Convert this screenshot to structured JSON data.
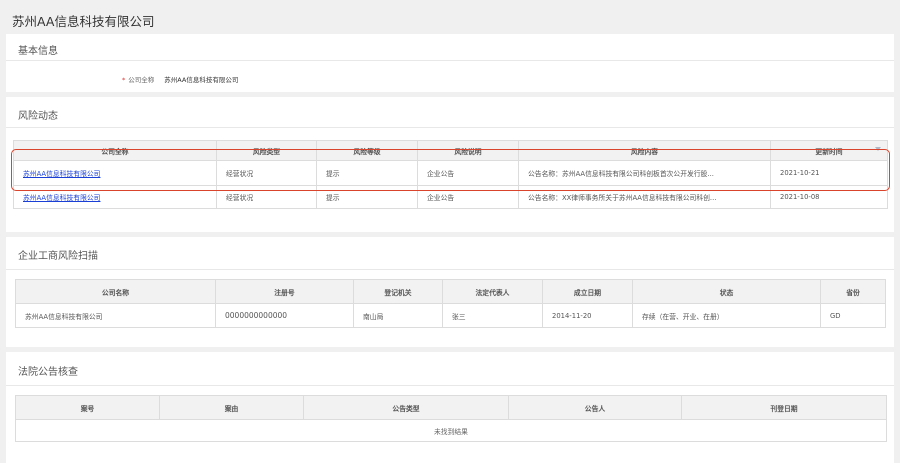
{
  "page": {
    "title": "苏州AA信息科技有限公司"
  },
  "basic_info": {
    "section_title": "基本信息",
    "field_label": "公司全称",
    "field_value": "苏州AA信息科技有限公司"
  },
  "risk": {
    "section_title": "风险动态",
    "headers": [
      "公司全称",
      "风险类型",
      "风险等级",
      "风险说明",
      "风险内容",
      "更新时间"
    ],
    "rows": [
      {
        "company": "苏州AA信息科技有限公司",
        "type": "经营状况",
        "level": "提示",
        "desc": "企业公告",
        "content": "公告名称：苏州AA信息科技有限公司科创板首次公开发行股...",
        "date": "2021-10-21"
      },
      {
        "company": "苏州AA信息科技有限公司",
        "type": "经营状况",
        "level": "提示",
        "desc": "企业公告",
        "content": "公告名称：XX律师事务所关于苏州AA信息科技有限公司科创...",
        "date": "2021-10-08"
      }
    ]
  },
  "biz": {
    "section_title": "企业工商风险扫描",
    "headers": [
      "公司名称",
      "注册号",
      "登记机关",
      "法定代表人",
      "成立日期",
      "状态",
      "省份"
    ],
    "rows": [
      {
        "name": "苏州AA信息科技有限公司",
        "reg_no": "0000000000000",
        "authority": "南山局",
        "rep": "张三",
        "founded": "2014-11-20",
        "status": "存续（在营、开业、在册）",
        "province": "GD"
      }
    ]
  },
  "court": {
    "section_title": "法院公告核查",
    "headers": [
      "案号",
      "案由",
      "公告类型",
      "公告人",
      "刊登日期"
    ],
    "empty_text": "未找到结果"
  },
  "colors": {
    "link": "#1a3fd6",
    "highlight": "#d9442c",
    "required": "#e0322b"
  }
}
